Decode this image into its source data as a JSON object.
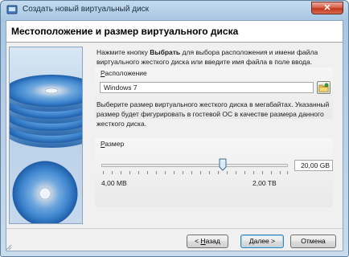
{
  "window": {
    "title": "Создать новый виртуальный диск",
    "close_label": "✕"
  },
  "header": {
    "title": "Местоположение и размер виртуального диска"
  },
  "location": {
    "instruction_prefix": "Нажмите кнопку ",
    "instruction_bold": "Выбрать",
    "instruction_suffix": " для выбора расположения и имени файла виртуального жесткого диска или введите имя файла в поле ввода.",
    "label_accel": "Р",
    "label_rest": "асположение",
    "value": "Windows 7",
    "browse_icon": "folder-icon"
  },
  "size": {
    "instruction": "Выберите размер виртуального жесткого диска в мегабайтах. Указанный размер будет фигурировать в гостевой ОС в качестве размера данного жесткого диска.",
    "label_accel": "Р",
    "label_rest": "азмер",
    "value": "20,00 GB",
    "min_label": "4,00 MB",
    "max_label": "2,00 TB",
    "slider_level": 0.65
  },
  "buttons": {
    "back_prefix": "< ",
    "back_accel": "Н",
    "back_rest": "азад",
    "next_accel": "Д",
    "next_rest": "алее >",
    "cancel": "Отмена"
  },
  "colors": {
    "title_bar": "#a9c7e3",
    "close_button": "#c2351b",
    "default_button_border": "#3c7fb1"
  }
}
